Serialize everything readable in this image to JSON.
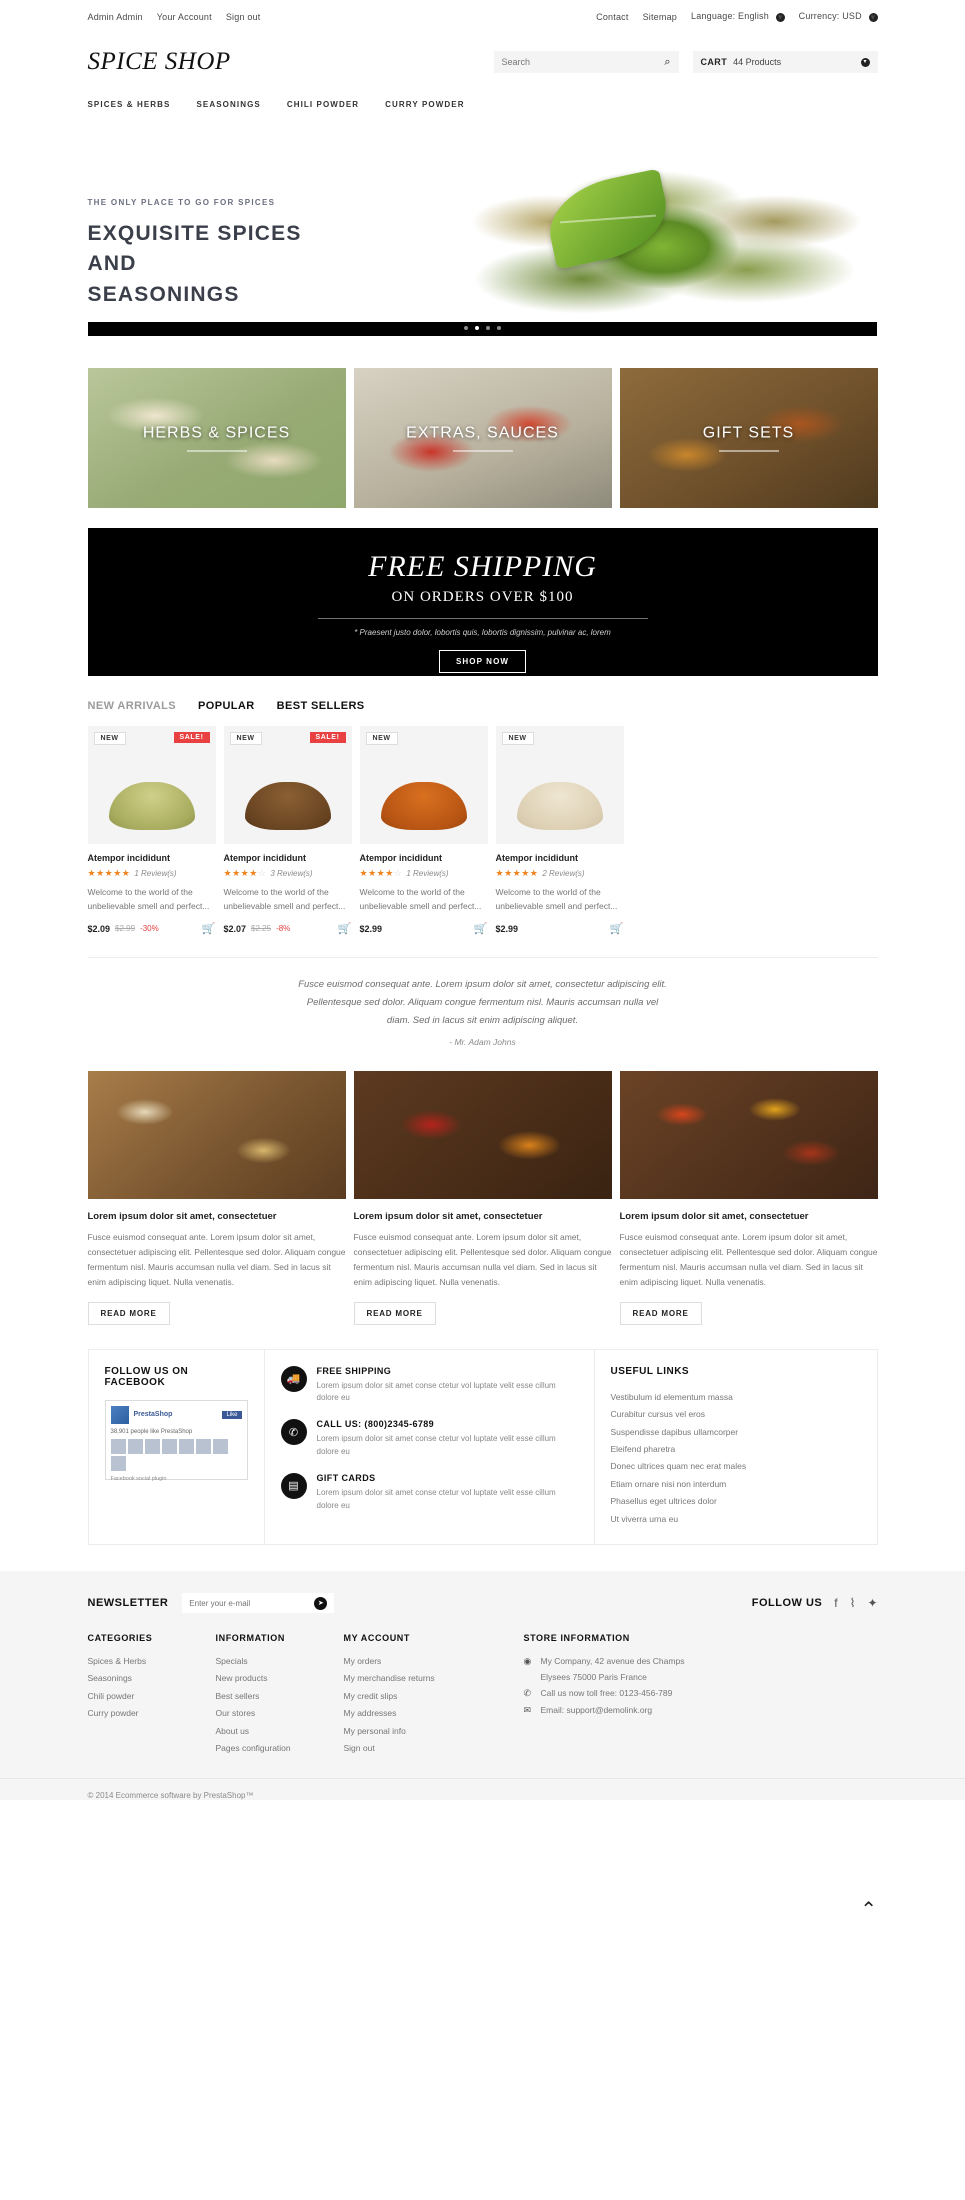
{
  "topbar": {
    "left": [
      {
        "label": "Admin Admin"
      },
      {
        "label": "Your Account"
      },
      {
        "label": "Sign out"
      }
    ],
    "right": [
      {
        "label": "Contact"
      },
      {
        "label": "Sitemap"
      }
    ],
    "language_label": "Language:",
    "language_value": "English",
    "currency_label": "Currency:",
    "currency_value": "USD",
    "caret_glyph": "▾"
  },
  "header": {
    "logo": "SPICE SHOP",
    "search_placeholder": "Search",
    "search_value": "",
    "search_icon": "⌕",
    "cart_label": "CART",
    "cart_count": "44 Products",
    "cart_caret": "▾"
  },
  "nav": {
    "items": [
      {
        "label": "SPICES & HERBS"
      },
      {
        "label": "SEASONINGS"
      },
      {
        "label": "CHILI POWDER"
      },
      {
        "label": "CURRY POWDER"
      }
    ]
  },
  "hero": {
    "eyebrow": "THE ONLY PLACE TO GO FOR SPICES",
    "title_line1": "EXQUISITE SPICES",
    "title_line2": "AND",
    "title_line3": "SEASONINGS",
    "slides": 4,
    "active_slide": 1
  },
  "tiles": [
    {
      "caption": "HERBS & SPICES"
    },
    {
      "caption": "EXTRAS, SAUCES"
    },
    {
      "caption": "GIFT SETS"
    }
  ],
  "banner": {
    "headline": "FREE SHIPPING",
    "subline": "ON ORDERS OVER $100",
    "note": "* Praesent justo dolor, lobortis quis, lobortis dignissim, pulvinar ac, lorem",
    "button": "SHOP NOW"
  },
  "products": {
    "tabs": [
      {
        "label": "NEW ARRIVALS",
        "active": false
      },
      {
        "label": "POPULAR",
        "active": true
      },
      {
        "label": "BEST SELLERS",
        "active": true
      }
    ],
    "items": [
      {
        "name": "Atempor incididunt",
        "badge_new": "NEW",
        "badge_sale": "SALE!",
        "stars_full": 5,
        "reviews": "1 Review(s)",
        "desc": "Welcome to the world of the unbelievable smell and perfect...",
        "price": "$2.09",
        "old_price": "$2.99",
        "discount": "-30%",
        "cart_icon": "🛒"
      },
      {
        "name": "Atempor incididunt",
        "badge_new": "NEW",
        "badge_sale": "SALE!",
        "stars_full": 4,
        "reviews": "3 Review(s)",
        "desc": "Welcome to the world of the unbelievable smell and perfect...",
        "price": "$2.07",
        "old_price": "$2.25",
        "discount": "-8%",
        "cart_icon": "🛒"
      },
      {
        "name": "Atempor incididunt",
        "badge_new": "NEW",
        "badge_sale": "",
        "stars_full": 4,
        "reviews": "1 Review(s)",
        "desc": "Welcome to the world of the unbelievable smell and perfect...",
        "price": "$2.99",
        "old_price": "",
        "discount": "",
        "cart_icon": "🛒"
      },
      {
        "name": "Atempor incididunt",
        "badge_new": "NEW",
        "badge_sale": "",
        "stars_full": 5,
        "reviews": "2 Review(s)",
        "desc": "Welcome to the world of the unbelievable smell and perfect...",
        "price": "$2.99",
        "old_price": "",
        "discount": "",
        "cart_icon": "🛒"
      }
    ]
  },
  "quote": {
    "line1": "Fusce euismod consequat ante. Lorem ipsum dolor sit amet, consectetur adipiscing elit.",
    "line2": "Pellentesque sed dolor. Aliquam congue fermentum nisl. Mauris accumsan nulla vel",
    "line3": "diam. Sed in lacus sit enim adipiscing aliquet.",
    "author": "- Mr. Adam Johns"
  },
  "blog": {
    "posts": [
      {
        "title": "Lorem ipsum dolor sit amet, consectetuer",
        "body": "Fusce euismod consequat ante. Lorem ipsum dolor sit amet, consectetuer adipiscing elit. Pellentesque sed dolor. Aliquam congue fermentum nisl. Mauris accumsan nulla vel diam. Sed in lacus sit enim adipiscing liquet. Nulla venenatis.",
        "button": "READ MORE"
      },
      {
        "title": "Lorem ipsum dolor sit amet, consectetuer",
        "body": "Fusce euismod consequat ante. Lorem ipsum dolor sit amet, consectetuer adipiscing elit. Pellentesque sed dolor. Aliquam congue fermentum nisl. Mauris accumsan nulla vel diam. Sed in lacus sit enim adipiscing liquet. Nulla venenatis.",
        "button": "READ MORE"
      },
      {
        "title": "Lorem ipsum dolor sit amet, consectetuer",
        "body": "Fusce euismod consequat ante. Lorem ipsum dolor sit amet, consectetuer adipiscing elit. Pellentesque sed dolor. Aliquam congue fermentum nisl. Mauris accumsan nulla vel diam. Sed in lacus sit enim adipiscing liquet. Nulla venenatis.",
        "button": "READ MORE"
      }
    ]
  },
  "info": {
    "facebook": {
      "title": "FOLLOW US ON FACEBOOK",
      "page_name": "PrestaShop",
      "like_label": "Like",
      "count_text": "38,901 people like PrestaShop",
      "plugin_label": "Facebook social plugin"
    },
    "services": [
      {
        "icon": "truck-icon",
        "glyph": "🚚",
        "title": "FREE SHIPPING",
        "desc": "Lorem ipsum dolor sit amet conse ctetur vol luptate velit esse cillum dolore eu"
      },
      {
        "icon": "phone-icon",
        "glyph": "✆",
        "title": "CALL US: (800)2345-6789",
        "desc": "Lorem ipsum dolor sit amet conse ctetur vol luptate velit esse cillum dolore eu"
      },
      {
        "icon": "giftcard-icon",
        "glyph": "▤",
        "title": "GIFT CARDS",
        "desc": "Lorem ipsum dolor sit amet conse ctetur vol luptate velit esse cillum dolore eu"
      }
    ],
    "useful_links": {
      "title": "USEFUL LINKS",
      "items": [
        "Vestibulum id elementum massa",
        "Curabitur cursus vel eros",
        "Suspendisse dapibus ullamcorper",
        "Eleifend pharetra",
        "Donec ultrices quam nec erat males",
        "Etiam ornare nisi non interdum",
        "Phasellus eget ultrices dolor",
        "Ut viverra urna eu"
      ]
    }
  },
  "scroll_top_icon": "^",
  "footer": {
    "newsletter_label": "NEWSLETTER",
    "newsletter_placeholder": "Enter your e-mail",
    "newsletter_value": "",
    "newsletter_go": "➤",
    "follow_label": "FOLLOW US",
    "social": [
      {
        "name": "facebook-icon",
        "glyph": "f"
      },
      {
        "name": "rss-icon",
        "glyph": "🜶"
      },
      {
        "name": "twitter-icon",
        "glyph": "🐦"
      }
    ],
    "columns": [
      {
        "title": "CATEGORIES",
        "items": [
          "Spices & Herbs",
          "Seasonings",
          "Chili powder",
          "Curry powder"
        ]
      },
      {
        "title": "INFORMATION",
        "items": [
          "Specials",
          "New products",
          "Best sellers",
          "Our stores",
          "About us",
          "Pages configuration"
        ]
      },
      {
        "title": "MY ACCOUNT",
        "items": [
          "My orders",
          "My merchandise returns",
          "My credit slips",
          "My addresses",
          "My personal info",
          "Sign out"
        ]
      }
    ],
    "store": {
      "title": "STORE INFORMATION",
      "address_line1": "My Company, 42 avenue des Champs",
      "address_line2": "Elysees 75000 Paris France",
      "phone": "Call us now toll free: 0123-456-789",
      "email": "Email: support@demolink.org",
      "pin_icon": "📍",
      "phone_icon": "✆",
      "mail_icon": "✉"
    },
    "copyright": "© 2014 Ecommerce software by PrestaShop™"
  }
}
